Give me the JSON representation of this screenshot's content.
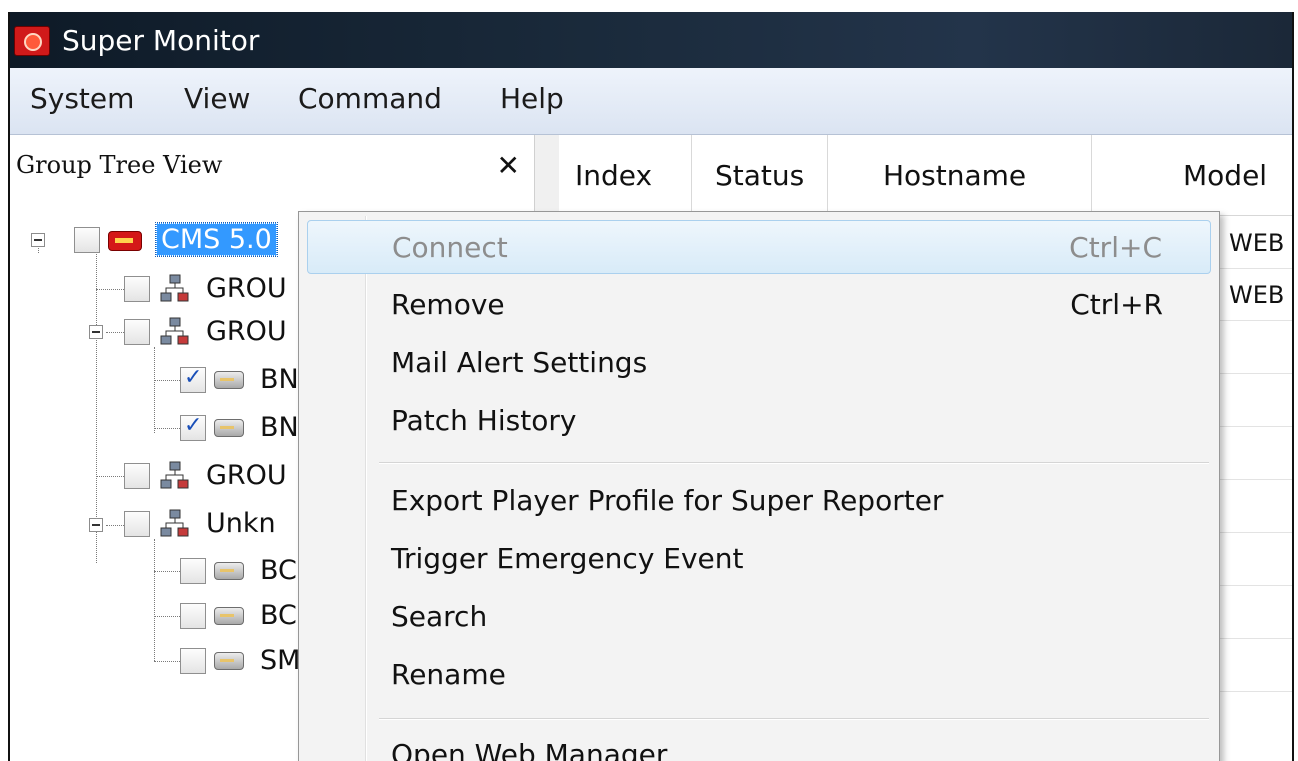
{
  "window": {
    "title": "Super Monitor",
    "icon": "app-icon"
  },
  "menubar": {
    "items": [
      "System",
      "View",
      "Command",
      "Help"
    ]
  },
  "tree_panel": {
    "title": "Group Tree View",
    "close_glyph": "✕",
    "nodes": [
      {
        "label": "CMS 5.0",
        "icon": "server-icon",
        "checked": false,
        "selected": true
      },
      {
        "label": "GROU",
        "icon": "network-icon",
        "checked": false
      },
      {
        "label": "GROU",
        "icon": "network-icon",
        "checked": false
      },
      {
        "label": "BN",
        "icon": "device-icon",
        "checked": true
      },
      {
        "label": "BN",
        "icon": "device-icon",
        "checked": true
      },
      {
        "label": "GROU",
        "icon": "network-icon",
        "checked": false
      },
      {
        "label": "Unkn",
        "icon": "network-icon",
        "checked": false
      },
      {
        "label": "BC",
        "icon": "device-icon",
        "checked": false
      },
      {
        "label": "BC",
        "icon": "device-icon",
        "checked": false
      },
      {
        "label": "SM",
        "icon": "device-icon",
        "checked": false
      }
    ]
  },
  "table": {
    "columns": [
      "Index",
      "Status",
      "Hostname",
      "Model"
    ],
    "rows": [
      {
        "model": "WEB"
      },
      {
        "model": "WEB"
      }
    ]
  },
  "context_menu": {
    "items": [
      {
        "label": "Connect",
        "shortcut": "Ctrl+C",
        "disabled": true,
        "highlighted": true
      },
      {
        "label": "Remove",
        "shortcut": "Ctrl+R"
      },
      {
        "label": "Mail Alert Settings"
      },
      {
        "label": "Patch History"
      },
      {
        "label": "Export Player Profile for Super Reporter"
      },
      {
        "label": "Trigger Emergency Event"
      },
      {
        "label": "Search"
      },
      {
        "label": "Rename"
      },
      {
        "label": "Open Web Manager"
      }
    ]
  }
}
